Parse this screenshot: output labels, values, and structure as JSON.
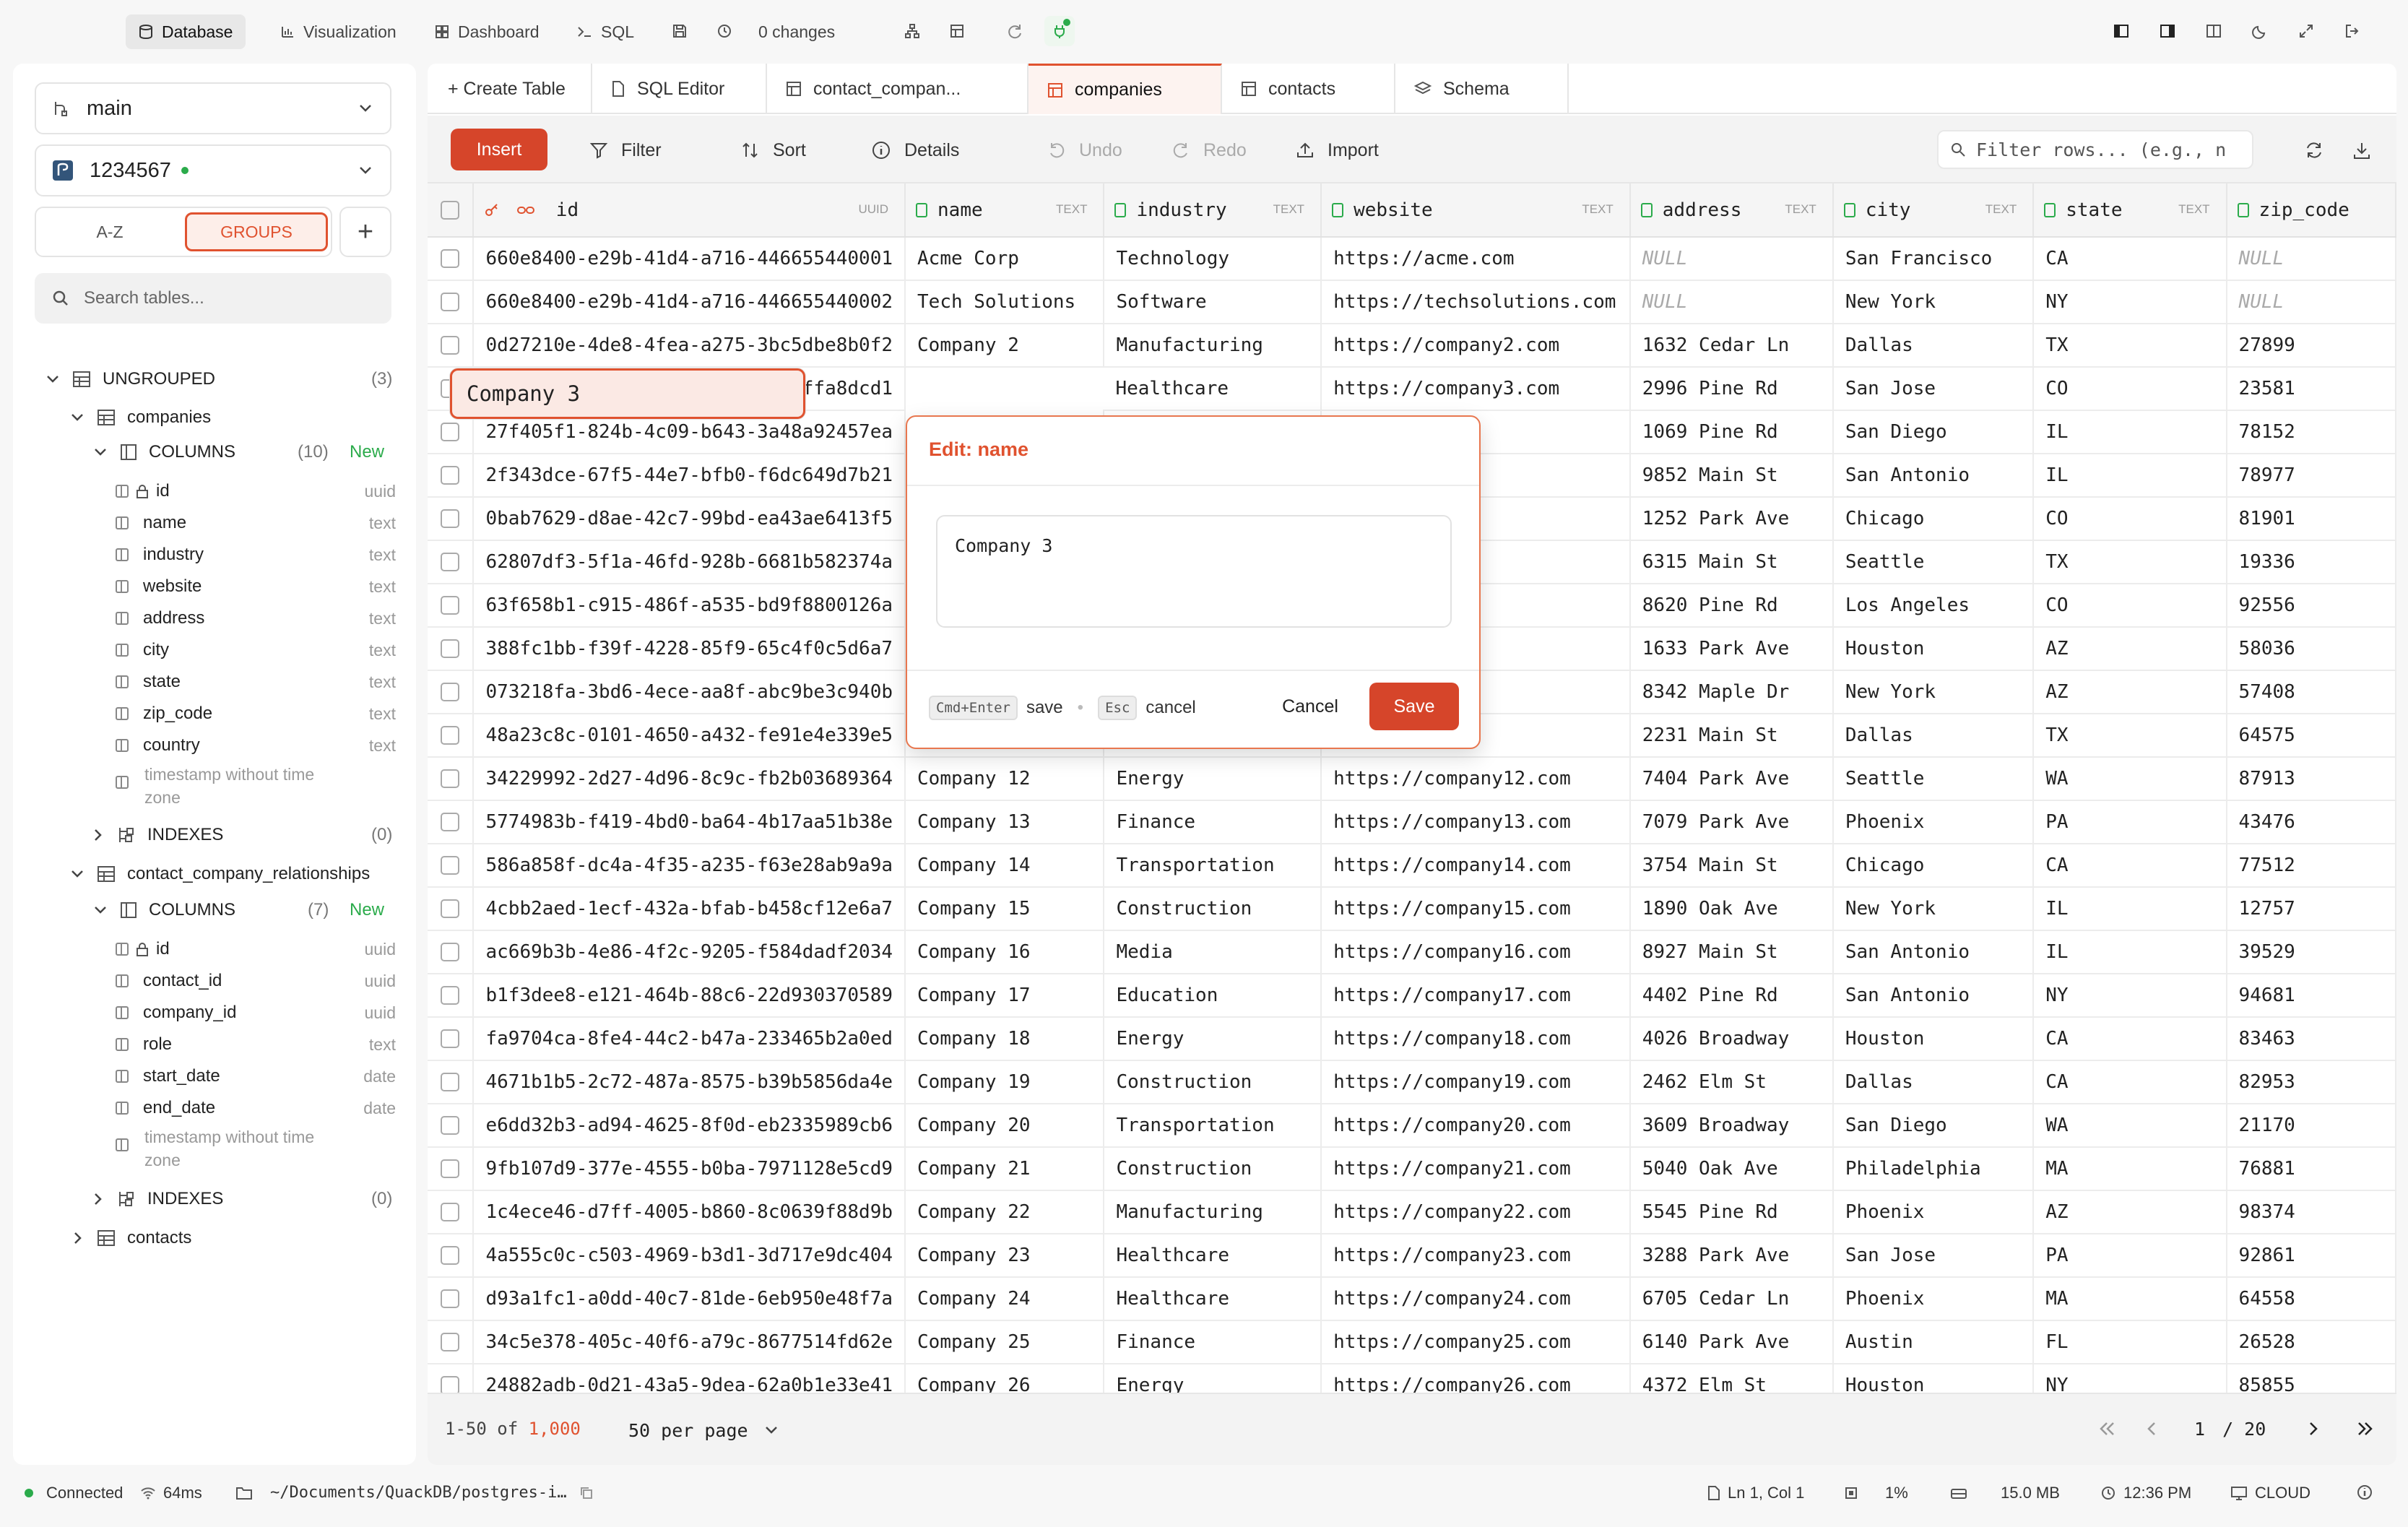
{
  "topbar": {
    "nav": [
      {
        "label": "Database",
        "icon": "database-icon",
        "active": true
      },
      {
        "label": "Visualization",
        "icon": "chart-icon",
        "active": false
      },
      {
        "label": "Dashboard",
        "icon": "dashboard-icon",
        "active": false
      },
      {
        "label": "SQL",
        "icon": "terminal-icon",
        "active": false
      }
    ],
    "changes": "0 changes"
  },
  "sidebar": {
    "branch": "main",
    "database": "1234567",
    "sort_az": "A-Z",
    "sort_groups": "GROUPS",
    "search_placeholder": "Search tables...",
    "ungrouped_label": "UNGROUPED",
    "ungrouped_count": "(3)",
    "tables": [
      {
        "name": "companies",
        "columns_label": "COLUMNS",
        "columns_count": "(10)",
        "new_label": "New",
        "columns": [
          {
            "name": "id",
            "type": "uuid"
          },
          {
            "name": "name",
            "type": "text"
          },
          {
            "name": "industry",
            "type": "text"
          },
          {
            "name": "website",
            "type": "text"
          },
          {
            "name": "address",
            "type": "text"
          },
          {
            "name": "city",
            "type": "text"
          },
          {
            "name": "state",
            "type": "text"
          },
          {
            "name": "zip_code",
            "type": "text"
          },
          {
            "name": "country",
            "type": "text"
          },
          {
            "name": "timestamp without time zone",
            "type": ""
          }
        ],
        "indexes_label": "INDEXES",
        "indexes_count": "(0)"
      },
      {
        "name": "contact_company_relationships",
        "columns_label": "COLUMNS",
        "columns_count": "(7)",
        "new_label": "New",
        "columns": [
          {
            "name": "id",
            "type": "uuid"
          },
          {
            "name": "contact_id",
            "type": "uuid"
          },
          {
            "name": "company_id",
            "type": "uuid"
          },
          {
            "name": "role",
            "type": "text"
          },
          {
            "name": "start_date",
            "type": "date"
          },
          {
            "name": "end_date",
            "type": "date"
          },
          {
            "name": "timestamp without time zone",
            "type": ""
          }
        ],
        "indexes_label": "INDEXES",
        "indexes_count": "(0)"
      },
      {
        "name": "contacts"
      }
    ]
  },
  "tabs": [
    {
      "label": "+ Create Table",
      "icon": ""
    },
    {
      "label": "SQL Editor",
      "icon": "file-icon"
    },
    {
      "label": "contact_compan...",
      "icon": "table-icon"
    },
    {
      "label": "companies",
      "icon": "table-icon",
      "active": true
    },
    {
      "label": "contacts",
      "icon": "table-icon"
    },
    {
      "label": "Schema",
      "icon": "layers-icon"
    }
  ],
  "toolbar": {
    "insert": "Insert",
    "filter": "Filter",
    "sort": "Sort",
    "details": "Details",
    "undo": "Undo",
    "redo": "Redo",
    "import": "Import",
    "filter_placeholder": "Filter rows... (e.g., n"
  },
  "grid": {
    "columns": [
      {
        "name": "id",
        "type": "UUID"
      },
      {
        "name": "name",
        "type": "TEXT"
      },
      {
        "name": "industry",
        "type": "TEXT"
      },
      {
        "name": "website",
        "type": "TEXT"
      },
      {
        "name": "address",
        "type": "TEXT"
      },
      {
        "name": "city",
        "type": "TEXT"
      },
      {
        "name": "state",
        "type": "TEXT"
      },
      {
        "name": "zip_code",
        "type": ""
      }
    ],
    "rows": [
      [
        "660e8400-e29b-41d4-a716-446655440001",
        "Acme Corp",
        "Technology",
        "https://acme.com",
        "NULL",
        "San Francisco",
        "CA",
        "NULL"
      ],
      [
        "660e8400-e29b-41d4-a716-446655440002",
        "Tech Solutions",
        "Software",
        "https://techsolutions.com",
        "NULL",
        "New York",
        "NY",
        "NULL"
      ],
      [
        "0d27210e-4de8-4fea-a275-3bc5dbe8b0f2",
        "Company 2",
        "Manufacturing",
        "https://company2.com",
        "1632 Cedar Ln",
        "Dallas",
        "TX",
        "27899"
      ],
      [
        "f5b78f25-cffd-4d30-a7a2-f8b2ffa8dcd1",
        "Company 3",
        "Healthcare",
        "https://company3.com",
        "2996 Pine Rd",
        "San Jose",
        "CO",
        "23581"
      ],
      [
        "27f405f1-824b-4c09-b643-3a48a92457ea",
        "",
        "",
        "ny4.com",
        "1069 Pine Rd",
        "San Diego",
        "IL",
        "78152"
      ],
      [
        "2f343dce-67f5-44e7-bfb0-f6dc649d7b21",
        "",
        "",
        "ny5.com",
        "9852 Main St",
        "San Antonio",
        "IL",
        "78977"
      ],
      [
        "0bab7629-d8ae-42c7-99bd-ea43ae6413f5",
        "",
        "",
        "ny6.com",
        "1252 Park Ave",
        "Chicago",
        "CO",
        "81901"
      ],
      [
        "62807df3-5f1a-46fd-928b-6681b582374a",
        "",
        "",
        "ny7.com",
        "6315 Main St",
        "Seattle",
        "TX",
        "19336"
      ],
      [
        "63f658b1-c915-486f-a535-bd9f8800126a",
        "",
        "",
        "ny8.com",
        "8620 Pine Rd",
        "Los Angeles",
        "CO",
        "92556"
      ],
      [
        "388fc1bb-f39f-4228-85f9-65c4f0c5d6a7",
        "",
        "",
        "ny9.com",
        "1633 Park Ave",
        "Houston",
        "AZ",
        "58036"
      ],
      [
        "073218fa-3bd6-4ece-aa8f-abc9be3c940b",
        "",
        "",
        "ny10.com",
        "8342 Maple Dr",
        "New York",
        "AZ",
        "57408"
      ],
      [
        "48a23c8c-0101-4650-a432-fe91e4e339e5",
        "",
        "",
        "ny11.com",
        "2231 Main St",
        "Dallas",
        "TX",
        "64575"
      ],
      [
        "34229992-2d27-4d96-8c9c-fb2b03689364",
        "Company 12",
        "Energy",
        "https://company12.com",
        "7404 Park Ave",
        "Seattle",
        "WA",
        "87913"
      ],
      [
        "5774983b-f419-4bd0-ba64-4b17aa51b38e",
        "Company 13",
        "Finance",
        "https://company13.com",
        "7079 Park Ave",
        "Phoenix",
        "PA",
        "43476"
      ],
      [
        "586a858f-dc4a-4f35-a235-f63e28ab9a9a",
        "Company 14",
        "Transportation",
        "https://company14.com",
        "3754 Main St",
        "Chicago",
        "CA",
        "77512"
      ],
      [
        "4cbb2aed-1ecf-432a-bfab-b458cf12e6a7",
        "Company 15",
        "Construction",
        "https://company15.com",
        "1890 Oak Ave",
        "New York",
        "IL",
        "12757"
      ],
      [
        "ac669b3b-4e86-4f2c-9205-f584dadf2034",
        "Company 16",
        "Media",
        "https://company16.com",
        "8927 Main St",
        "San Antonio",
        "IL",
        "39529"
      ],
      [
        "b1f3dee8-e121-464b-88c6-22d930370589",
        "Company 17",
        "Education",
        "https://company17.com",
        "4402 Pine Rd",
        "San Antonio",
        "NY",
        "94681"
      ],
      [
        "fa9704ca-8fe4-44c2-b47a-233465b2a0ed",
        "Company 18",
        "Energy",
        "https://company18.com",
        "4026 Broadway",
        "Houston",
        "CA",
        "83463"
      ],
      [
        "4671b1b5-2c72-487a-8575-b39b5856da4e",
        "Company 19",
        "Construction",
        "https://company19.com",
        "2462 Elm St",
        "Dallas",
        "CA",
        "82953"
      ],
      [
        "e6dd32b3-ad94-4625-8f0d-eb2335989cb6",
        "Company 20",
        "Transportation",
        "https://company20.com",
        "3609 Broadway",
        "San Diego",
        "WA",
        "21170"
      ],
      [
        "9fb107d9-377e-4555-b0ba-7971128e5cd9",
        "Company 21",
        "Construction",
        "https://company21.com",
        "5040 Oak Ave",
        "Philadelphia",
        "MA",
        "76881"
      ],
      [
        "1c4ece46-d7ff-4005-b860-8c0639f88d9b",
        "Company 22",
        "Manufacturing",
        "https://company22.com",
        "5545 Pine Rd",
        "Phoenix",
        "AZ",
        "98374"
      ],
      [
        "4a555c0c-c503-4969-b3d1-3d717e9dc404",
        "Company 23",
        "Healthcare",
        "https://company23.com",
        "3288 Park Ave",
        "San Jose",
        "PA",
        "92861"
      ],
      [
        "d93a1fc1-a0dd-40c7-81de-6eb950e48f7a",
        "Company 24",
        "Healthcare",
        "https://company24.com",
        "6705 Cedar Ln",
        "Phoenix",
        "MA",
        "64558"
      ],
      [
        "34c5e378-405c-40f6-a79c-8677514fd62e",
        "Company 25",
        "Finance",
        "https://company25.com",
        "6140 Park Ave",
        "Austin",
        "FL",
        "26528"
      ],
      [
        "24882adb-0d21-43a5-9dea-62a0b1e33e41",
        "Company 26",
        "Energy",
        "https://company26.com",
        "4372 Elm St",
        "Houston",
        "NY",
        "85855"
      ]
    ]
  },
  "footer": {
    "range": "1-50 of ",
    "total": "1,000",
    "per_page": "50 per page",
    "page": "1",
    "page_total": "/ 20"
  },
  "edit_popup": {
    "title": "Edit: name",
    "value": "Company 3",
    "save_key": "Cmd+Enter",
    "save_hint": "save",
    "cancel_key": "Esc",
    "cancel_hint": "cancel",
    "cancel_button": "Cancel",
    "save_button": "Save"
  },
  "statusbar": {
    "connected": "Connected",
    "latency": "64ms",
    "path": "~/Documents/QuackDB/postgres-i…",
    "cursor": "Ln 1, Col 1",
    "cpu": "1%",
    "memory": "15.0 MB",
    "time": "12:36 PM",
    "mode": "CLOUD"
  },
  "colors": {
    "accent": "#e0522f",
    "success": "#2bab4b"
  }
}
